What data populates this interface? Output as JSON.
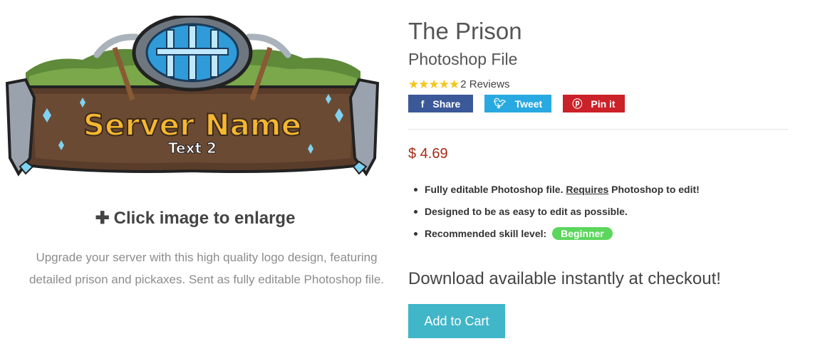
{
  "product": {
    "title": "The Prison",
    "subtitle": "Photoshop File",
    "rating_stars": 5,
    "reviews": "2 Reviews",
    "price": "$ 4.69"
  },
  "logo": {
    "line1": "Server Name",
    "line2": "Text 2"
  },
  "gallery": {
    "enlarge_label": "Click image to enlarge",
    "description": "Upgrade your server with this high quality logo design, featuring detailed prison and pickaxes. Sent as fully editable Photoshop file."
  },
  "social": {
    "share": "Share",
    "tweet": "Tweet",
    "pin": "Pin it"
  },
  "features": {
    "f1_a": "Fully editable Photoshop file.",
    "f1_link": "Requires",
    "f1_b": "Photoshop to edit!",
    "f2": "Designed to be as easy to edit as possible.",
    "f3": "Recommended skill level:",
    "skill_badge": "Beginner"
  },
  "checkout": {
    "download_text": "Download available instantly at checkout!",
    "add_to_cart": "Add to Cart"
  },
  "colors": {
    "facebook": "#3b5998",
    "twitter": "#29a9e1",
    "pinterest": "#cb2128",
    "price": "#a62a12",
    "cart_button": "#41b6c8",
    "badge": "#5cd65c",
    "star": "#f5c518"
  }
}
